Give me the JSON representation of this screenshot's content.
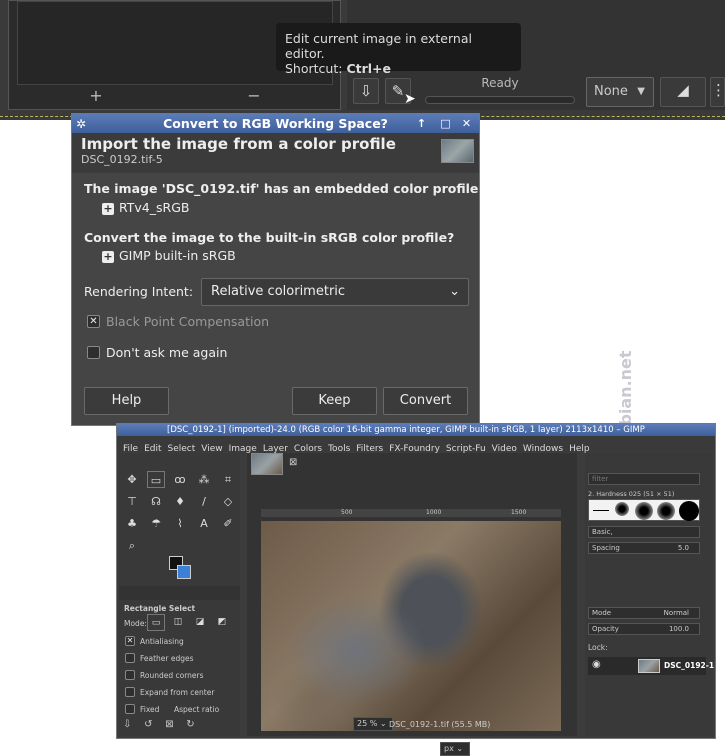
{
  "top_window": {
    "left_add": "+",
    "left_remove": "−",
    "tooltip_line1": "Edit current image in external editor.",
    "tooltip_line2_prefix": "Shortcut: ",
    "tooltip_line2_key": "Ctrl+e",
    "status": "Ready",
    "select_value": "None"
  },
  "dialog": {
    "title": "Convert to RGB Working Space?",
    "header": "Import the image from a color profile",
    "filename": "DSC_0192.tif-5",
    "embedded_text": "The image 'DSC_0192.tif' has an embedded color profile",
    "embedded_profile": "RTv4_sRGB",
    "convert_question": "Convert the image to the built-in sRGB color profile?",
    "builtin_profile": "GIMP built-in sRGB",
    "intent_label": "Rendering Intent:",
    "intent_value": "Relative colorimetric",
    "bpc_label": "Black Point Compensation",
    "dont_ask_label": "Don't ask me again",
    "help": "Help",
    "keep": "Keep",
    "convert": "Convert"
  },
  "watermark": "screenshots.debian.net",
  "gimp": {
    "title": "[DSC_0192-1] (imported)-24.0 (RGB color 16-bit gamma integer, GIMP built-in sRGB, 1 layer) 2113x1410 – GIMP",
    "menu": [
      "File",
      "Edit",
      "Select",
      "View",
      "Image",
      "Layer",
      "Colors",
      "Tools",
      "Filters",
      "FX-Foundry",
      "Script-Fu",
      "Video",
      "Windows",
      "Help"
    ],
    "tool_options_title": "Rectangle Select",
    "mode_label": "Mode:",
    "options": [
      "Antialiasing",
      "Feather edges",
      "Rounded corners",
      "Expand from center"
    ],
    "fixed_label": "Fixed",
    "aspect_label": "Aspect ratio",
    "ruler": [
      "500",
      "1000",
      "1500"
    ],
    "unit": "px",
    "zoom": "25 %",
    "status_file": "DSC_0192-1.tif (55.5 MB)",
    "brush_filter": "filter",
    "brush_name": "2. Hardness 025 (51 × 51)",
    "brush_preset": "Basic,",
    "spacing_label": "Spacing",
    "spacing_value": "5.0",
    "layer_mode_label": "Mode",
    "layer_mode_value": "Normal",
    "opacity_label": "Opacity",
    "opacity_value": "100.0",
    "lock_label": "Lock:",
    "layer_name": "DSC_0192-1"
  }
}
